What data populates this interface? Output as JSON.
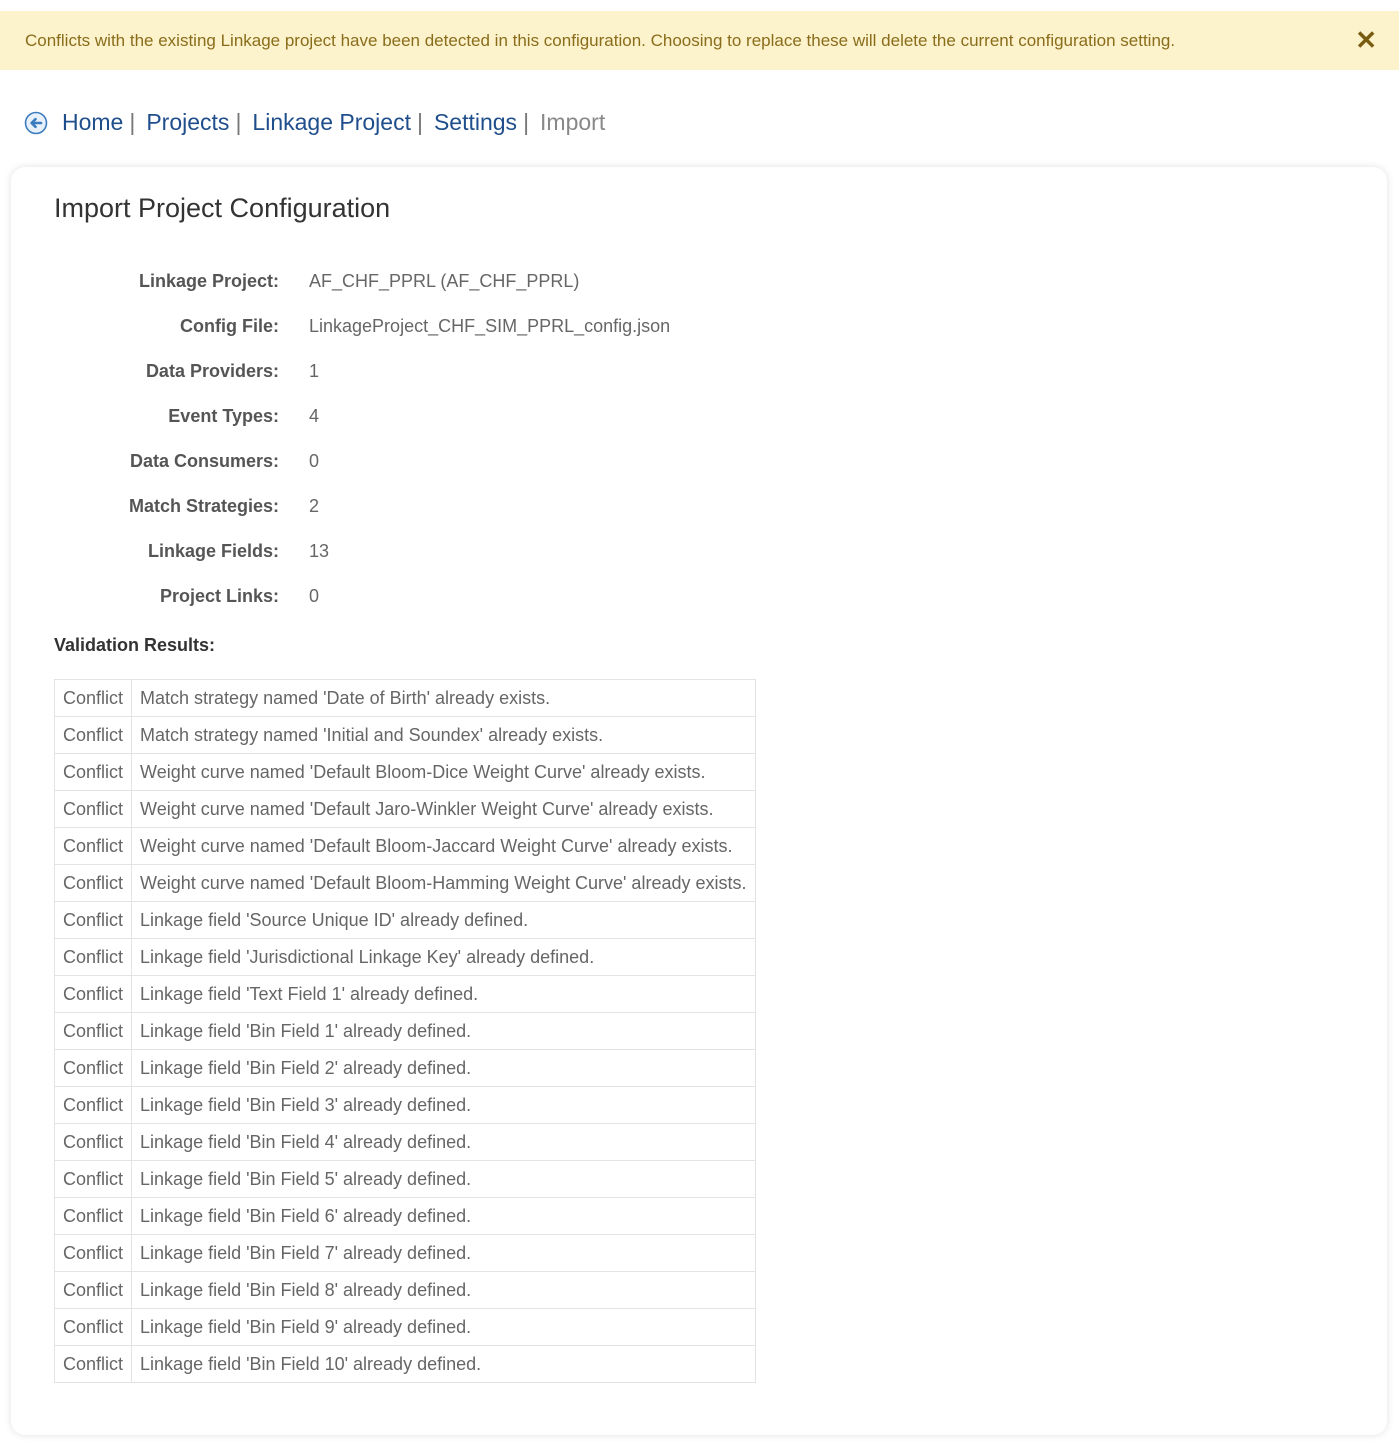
{
  "alert": {
    "message": "Conflicts with the existing Linkage project have been detected in this configuration. Choosing to replace these will delete the current configuration setting.",
    "close_glyph": "✕"
  },
  "breadcrumb": {
    "items": [
      "Home",
      "Projects",
      "Linkage Project",
      "Settings"
    ],
    "separator": "|",
    "current": "Import"
  },
  "panel": {
    "title": "Import Project Configuration",
    "fields": [
      {
        "label": "Linkage Project:",
        "value": "AF_CHF_PPRL (AF_CHF_PPRL)"
      },
      {
        "label": "Config File:",
        "value": "LinkageProject_CHF_SIM_PPRL_config.json"
      },
      {
        "label": "Data Providers:",
        "value": "1"
      },
      {
        "label": "Event Types:",
        "value": "4"
      },
      {
        "label": "Data Consumers:",
        "value": "0"
      },
      {
        "label": "Match Strategies:",
        "value": "2"
      },
      {
        "label": "Linkage Fields:",
        "value": "13"
      },
      {
        "label": "Project Links:",
        "value": "0"
      }
    ],
    "validation_title": "Validation Results:",
    "results": [
      {
        "status": "Conflict",
        "message": "Match strategy named 'Date of Birth' already exists."
      },
      {
        "status": "Conflict",
        "message": "Match strategy named 'Initial and Soundex' already exists."
      },
      {
        "status": "Conflict",
        "message": "Weight curve named 'Default Bloom-Dice Weight Curve' already exists."
      },
      {
        "status": "Conflict",
        "message": "Weight curve named 'Default Jaro-Winkler Weight Curve' already exists."
      },
      {
        "status": "Conflict",
        "message": "Weight curve named 'Default Bloom-Jaccard Weight Curve' already exists."
      },
      {
        "status": "Conflict",
        "message": "Weight curve named 'Default Bloom-Hamming Weight Curve' already exists."
      },
      {
        "status": "Conflict",
        "message": "Linkage field 'Source Unique ID' already defined."
      },
      {
        "status": "Conflict",
        "message": "Linkage field 'Jurisdictional Linkage Key' already defined."
      },
      {
        "status": "Conflict",
        "message": "Linkage field 'Text Field 1' already defined."
      },
      {
        "status": "Conflict",
        "message": "Linkage field 'Bin Field 1' already defined."
      },
      {
        "status": "Conflict",
        "message": "Linkage field 'Bin Field 2' already defined."
      },
      {
        "status": "Conflict",
        "message": "Linkage field 'Bin Field 3' already defined."
      },
      {
        "status": "Conflict",
        "message": "Linkage field 'Bin Field 4' already defined."
      },
      {
        "status": "Conflict",
        "message": "Linkage field 'Bin Field 5' already defined."
      },
      {
        "status": "Conflict",
        "message": "Linkage field 'Bin Field 6' already defined."
      },
      {
        "status": "Conflict",
        "message": "Linkage field 'Bin Field 7' already defined."
      },
      {
        "status": "Conflict",
        "message": "Linkage field 'Bin Field 8' already defined."
      },
      {
        "status": "Conflict",
        "message": "Linkage field 'Bin Field 9' already defined."
      },
      {
        "status": "Conflict",
        "message": "Linkage field 'Bin Field 10' already defined."
      }
    ]
  },
  "colors": {
    "alert_bg": "#fcf2cc",
    "alert_text": "#8a6d1b",
    "link": "#1f4e8c",
    "back_icon": "#3b7bbf"
  },
  "icons": {
    "back": "back-arrow-circle-icon",
    "close": "close-icon"
  }
}
